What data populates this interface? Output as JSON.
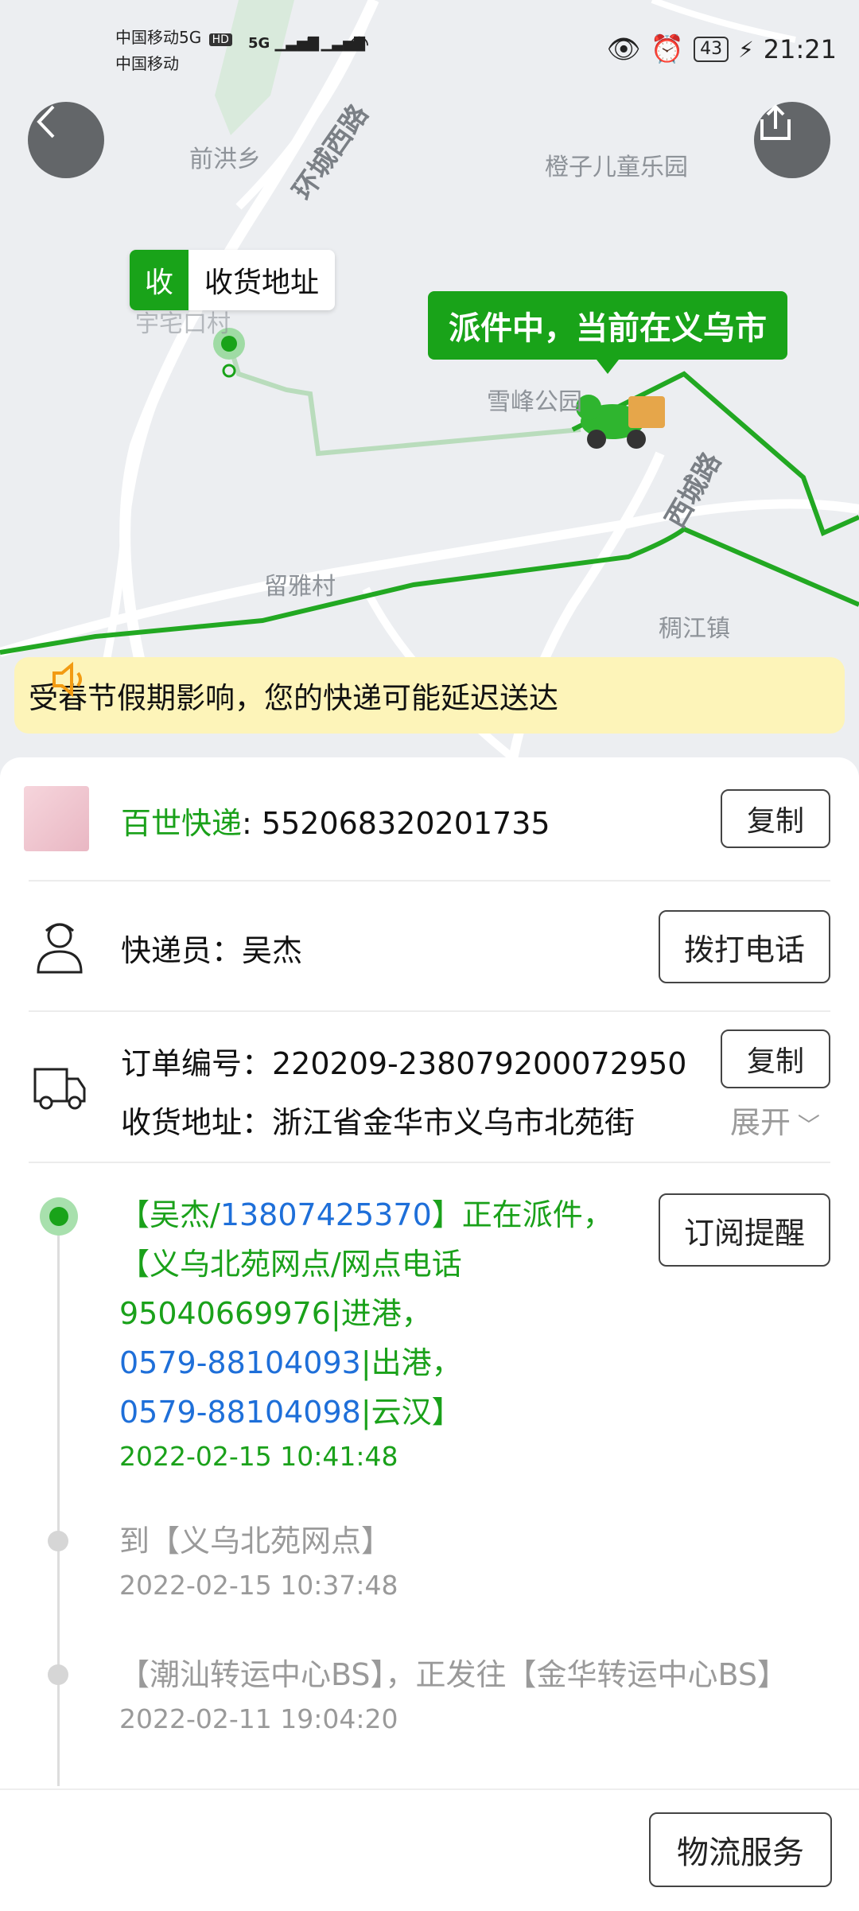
{
  "status_bar": {
    "carrier1": "中国移动5G",
    "hd_badge": "HD",
    "carrier2": "中国移动",
    "net1": "5G",
    "net2": "E",
    "battery": "43",
    "time": "21:21"
  },
  "map": {
    "places": [
      "前洪乡",
      "橙子儿童乐园",
      "宇宅口村",
      "雪峰公园",
      "留雅村",
      "稠江镇"
    ],
    "roads": [
      "环城西路",
      "西城路"
    ],
    "receiver_tag": "收",
    "receiver_label": "收货地址",
    "courier_bubble": "派件中，当前在义乌市"
  },
  "notice": {
    "text": "受春节假期影响，您的快递可能延迟送达"
  },
  "carrier": {
    "name": "百世快递",
    "colon": ":",
    "tracking_no": "552068320201735",
    "copy_label": "复制"
  },
  "courier": {
    "label": "快递员：吴杰",
    "call_label": "拨打电话"
  },
  "order": {
    "order_label": "订单编号：220209-238079200072950",
    "copy_label": "复制",
    "address_label": "收货地址：浙江省金华市义乌市北苑街",
    "expand_label": "展开"
  },
  "subscribe_label": "订阅提醒",
  "timeline": [
    {
      "line1a": "【吴杰/",
      "line1b": "13807425370",
      "line1c": "】正在派件，",
      "line2": "【义乌北苑网点/网点电话",
      "line3a": "95040669976",
      "line3b": "|进港，",
      "line4a": "0579-88104093",
      "line4b": "|出港，",
      "line5a": "0579-88104098",
      "line5b": "|云汉】",
      "time": "2022-02-15 10:41:48"
    },
    {
      "text": "到【义乌北苑网点】",
      "time": "2022-02-15 10:37:48"
    },
    {
      "text": "【潮汕转运中心BS】，正发往【金华转运中心BS】",
      "time": "2022-02-11 19:04:20"
    }
  ],
  "bottom": {
    "service_label": "物流服务"
  },
  "colors": {
    "accent_green": "#19a319",
    "link_blue": "#1e6fd9",
    "notice_bg": "#fdf4b9"
  }
}
